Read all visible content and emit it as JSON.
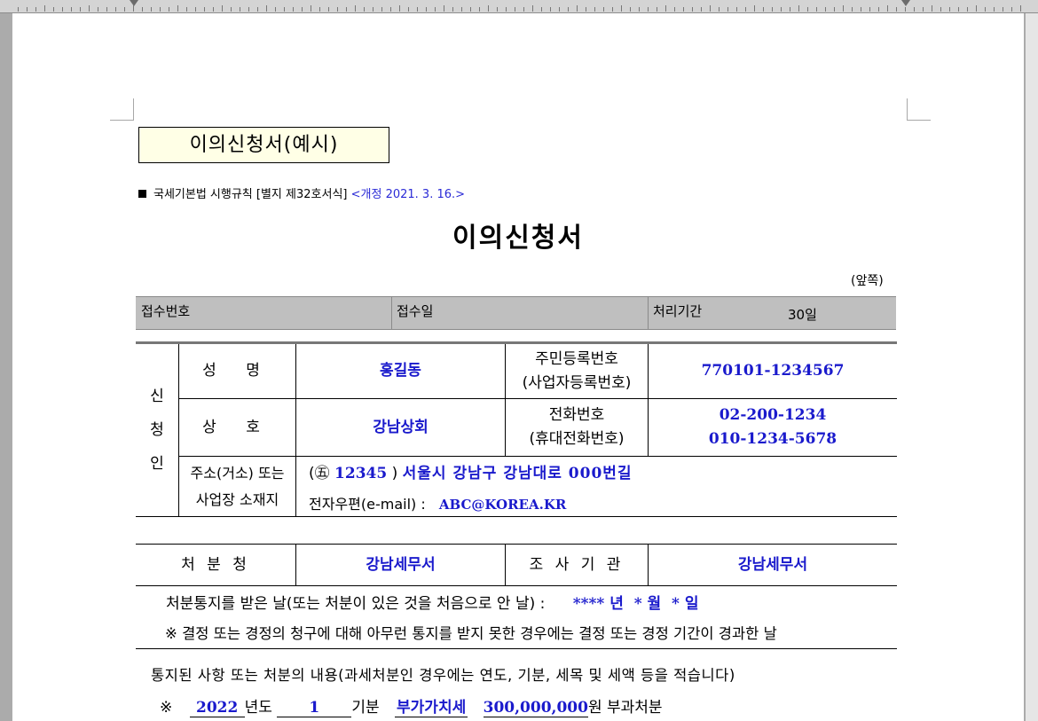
{
  "example_title": "이의신청서(예시)",
  "form_reference": {
    "text": "국세기본법 시행규칙 [별지 제32호서식]",
    "revision": "<개정 2021. 3. 16.>"
  },
  "document_title": "이의신청서",
  "page_side": "(앞쪽)",
  "receipt": {
    "number_label": "접수번호",
    "date_label": "접수일",
    "period_label": "처리기간",
    "period_value": "30일"
  },
  "applicant": {
    "section_label": [
      "신",
      "청",
      "인"
    ],
    "name_label": "성 명",
    "name_value": "홍길동",
    "rrn_label_1": "주민등록번호",
    "rrn_label_2": "(사업자등록번호)",
    "rrn_value": "770101-1234567",
    "trade_label": "상 호",
    "trade_value": "강남상회",
    "phone_label_1": "전화번호",
    "phone_label_2": "(휴대전화번호)",
    "phone_value_1": "02-200-1234",
    "phone_value_2": "010-1234-5678",
    "address_label_1": "주소(거소) 또는",
    "address_label_2": "사업장 소재지",
    "postal_prefix": "(㊄",
    "postal_code": "12345",
    "postal_suffix": ")",
    "address_value": "서울시 강남구 강남대로 000번길",
    "email_label": "전자우편(e-mail) :",
    "email_value": "ABC@KOREA.KR"
  },
  "disposition": {
    "office_label": "처 분 청",
    "office_value": "강남세무서",
    "investigator_label": "조 사 기 관",
    "investigator_value": "강남세무서",
    "notice_date_label": "처분통지를 받은 날(또는 처분이 있은 것을 처음으로 안 날) :",
    "notice_date_value": "**** 년  * 월  * 일",
    "note": "※ 결정 또는 경정의 청구에 대해 아무런 통지를 받지 못한 경우에는 결정 또는 경정 기간이 경과한 날"
  },
  "content": {
    "heading": "통지된 사항 또는 처분의 내용(과세처분인 경우에는 연도, 기분, 세목 및 세액 등을 적습니다)",
    "mark": "※",
    "year": "2022",
    "year_unit": "년도",
    "period": "1",
    "period_unit": "기분",
    "tax_item": "부가가치세",
    "amount": "300,000,000",
    "amount_unit": "원 부과처분"
  }
}
